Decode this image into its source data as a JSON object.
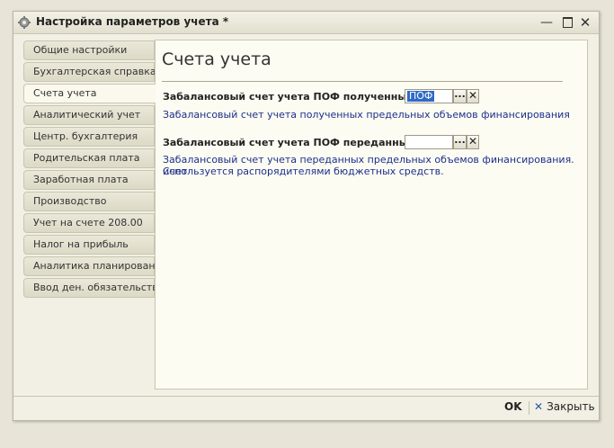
{
  "window": {
    "title": "Настройка параметров учета *",
    "controls": {
      "minimize": "—",
      "close": "✕"
    }
  },
  "tabs": [
    {
      "label": "Общие настройки",
      "active": false
    },
    {
      "label": "Бухгалтерская справка",
      "active": false
    },
    {
      "label": "Счета учета",
      "active": true
    },
    {
      "label": "Аналитический учет",
      "active": false
    },
    {
      "label": "Центр. бухгалтерия",
      "active": false
    },
    {
      "label": "Родительская плата",
      "active": false
    },
    {
      "label": "Заработная плата",
      "active": false
    },
    {
      "label": "Производство",
      "active": false
    },
    {
      "label": "Учет на счете 208.00",
      "active": false
    },
    {
      "label": "Налог на прибыль",
      "active": false
    },
    {
      "label": "Аналитика планирования",
      "active": false
    },
    {
      "label": "Ввод ден. обязательств",
      "active": false
    }
  ],
  "panel": {
    "title": "Счета учета",
    "fields": [
      {
        "label": "Забалансовый счет учета ПОФ полученных:",
        "value": "ПОФ",
        "select_label": "...",
        "clear_label": "✕",
        "hint": "Забалансовый счет учета полученных предельных объемов финансирования"
      },
      {
        "label": "Забалансовый счет учета ПОФ переданных:",
        "value": "",
        "select_label": "...",
        "clear_label": "✕",
        "hint_line1": "Забалансовый счет учета переданных предельных объемов финансирования. Счет",
        "hint_line2": "используется распорядителями бюджетных средств."
      }
    ]
  },
  "footer": {
    "ok_label": "OK",
    "close_icon": "✕",
    "close_label": "Закрыть"
  }
}
